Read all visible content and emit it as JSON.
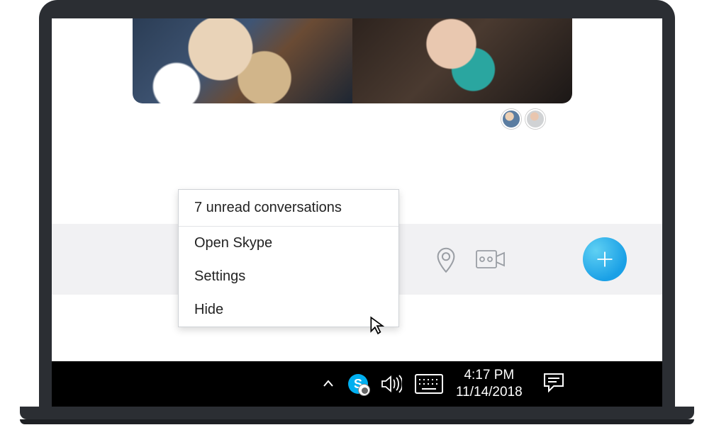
{
  "context_menu": {
    "header": "7 unread conversations",
    "items": [
      "Open Skype",
      "Settings",
      "Hide"
    ]
  },
  "compose": {
    "icons": [
      "location-icon",
      "video-message-icon"
    ],
    "fab": "add"
  },
  "taskbar": {
    "time": "4:17 PM",
    "date": "11/14/2018",
    "tray_icons": [
      "tray-chevron",
      "skype-tray",
      "volume",
      "keyboard",
      "action-center"
    ]
  },
  "colors": {
    "accent": "#1aa0e6",
    "menu_border": "#cfd2d6",
    "compose_bg": "#f1f1f3"
  }
}
